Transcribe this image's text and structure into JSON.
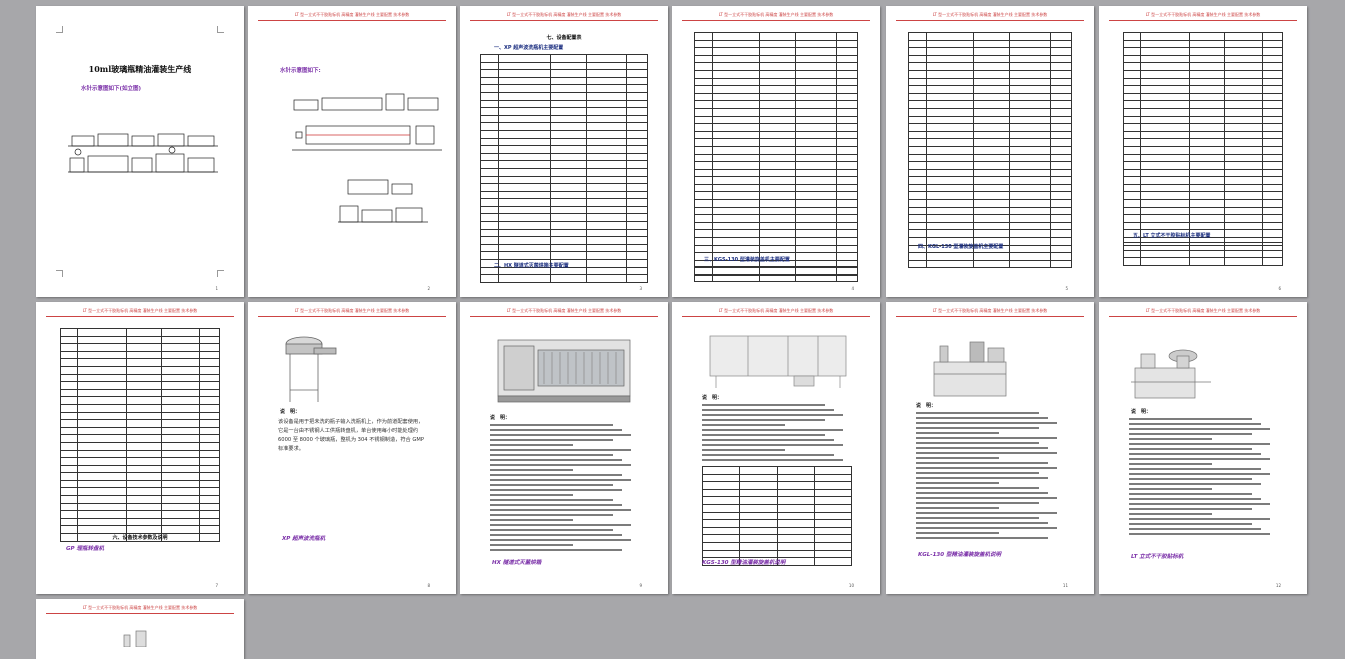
{
  "page1": {
    "title": "10ml玻璃瓶精油灌装生产线",
    "link": "水针示意图如下(如立图)"
  },
  "page2": {
    "link": "水针示意图如下:"
  },
  "page3": {
    "heading": "七、设备配置表",
    "section1": "一、XP 超声波洗瓶机主要配置",
    "section2": "二、HX 隧道式灭菌烘箱主要配置"
  },
  "page4": {
    "section": "三、KGS-130 型灌装旋盖机主要配置"
  },
  "page5": {
    "section": "四、KGL-130 型灌装旋盖机主要配置"
  },
  "page6": {
    "section": "五、LT 立式不干胶贴标机主要配置"
  },
  "page7": {
    "section": "六、设备技术参数及说明",
    "caption": "GP 理瓶转盘机"
  },
  "page8": {
    "label": "说　明：",
    "text": "该设备是用于把未洗的瓶子输入洗瓶机上，作为前道配套使用，它是一台由不锈钢人工供瓶转盘机，单台使用每小时能处理约 6000 至 8000 个玻璃瓶，整机为 304 不锈钢制造，符合 GMP 标准要求。",
    "caption": "XP 超声波洗瓶机"
  },
  "page9": {
    "label": "说　明：",
    "caption": "HX 隧道式灭菌烘箱"
  },
  "page10": {
    "label": "说　明：",
    "caption": "KGS-130 型精油灌装旋盖机说明"
  },
  "page11": {
    "label": "说　明：",
    "caption": "KGL-130 型精油灌装旋盖机说明"
  },
  "page12": {
    "label": "说　明：",
    "caption": "LT 立式不干胶贴标机"
  },
  "page_numbers": [
    "1",
    "2",
    "3",
    "4",
    "5",
    "6",
    "7",
    "8",
    "9",
    "10",
    "11",
    "12"
  ],
  "header_text": "LT 型—立式不干胶贴标机 高精度 灌装生产线 主要配置 技术参数"
}
